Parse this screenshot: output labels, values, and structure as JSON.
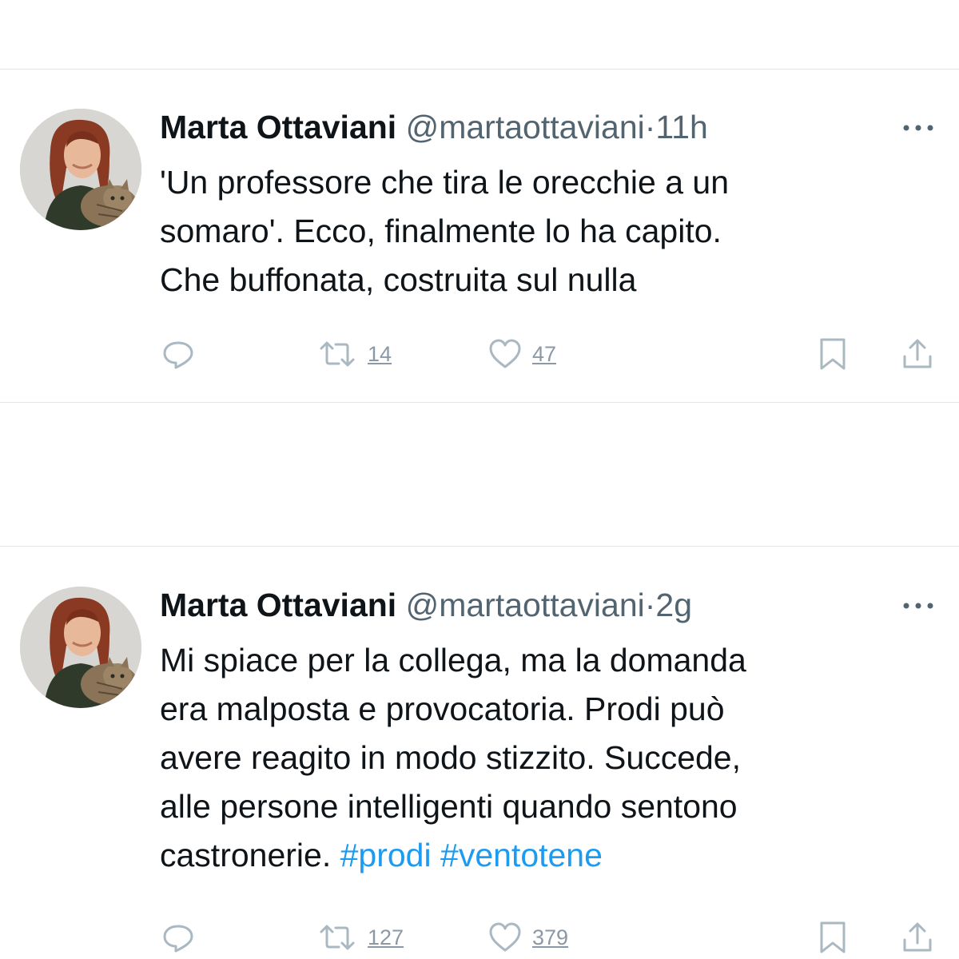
{
  "tweets": [
    {
      "author_name": "Marta Ottaviani",
      "author_handle": "@martaottaviani",
      "separator": "·",
      "time": "11h",
      "text_lines": [
        "'Un professore che tira le orecchie a un",
        "somaro'. Ecco, finalmente lo ha capito.",
        "Che buffonata, costruita sul nulla"
      ],
      "retweet_count": "14",
      "like_count": "47"
    },
    {
      "author_name": "Marta Ottaviani",
      "author_handle": "@martaottaviani",
      "separator": "·",
      "time": "2g",
      "text_lines": [
        "Mi spiace per la collega, ma la domanda",
        "era malposta e provocatoria. Prodi può",
        "avere reagito in modo stizzito. Succede,",
        "alle persone intelligenti quando sentono"
      ],
      "text_last_line_prefix": "castronerie.",
      "hashtags": [
        "#prodi",
        "#ventotene"
      ],
      "retweet_count": "127",
      "like_count": "379"
    }
  ],
  "icons": {
    "more": "more-horizontal-icon",
    "reply": "reply-bubble-icon",
    "retweet": "retweet-icon",
    "like": "heart-icon",
    "bookmark": "bookmark-icon",
    "share": "share-icon"
  },
  "colors": {
    "text": "#0f1419",
    "secondary": "#536471",
    "hashtag": "#1d9bf0",
    "action_icon": "#aab8c2",
    "divider": "#e3e6e9"
  }
}
